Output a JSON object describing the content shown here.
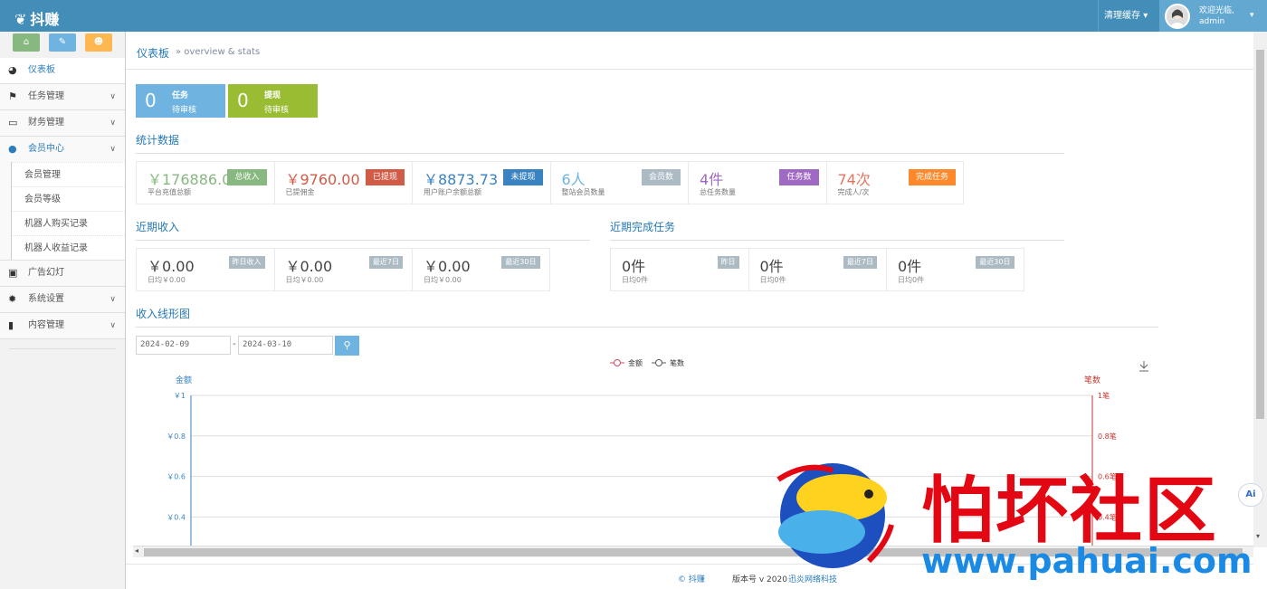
{
  "brand": {
    "name": "抖赚"
  },
  "header": {
    "clear_cache": "清理缓存",
    "welcome": "欢迎光临,",
    "user": "admin"
  },
  "sidebar": {
    "items": [
      {
        "label": "仪表板",
        "icon": "dashboard-icon"
      },
      {
        "label": "任务管理",
        "icon": "flag-icon"
      },
      {
        "label": "财务管理",
        "icon": "inbox-icon"
      },
      {
        "label": "会员中心",
        "icon": "user-icon"
      },
      {
        "label": "广告幻灯",
        "icon": "picture-icon"
      },
      {
        "label": "系统设置",
        "icon": "gear-icon"
      },
      {
        "label": "内容管理",
        "icon": "book-icon"
      }
    ],
    "member_sub": [
      "会员管理",
      "会员等级",
      "机器人购买记录",
      "机器人收益记录"
    ]
  },
  "breadcrumb": {
    "title": "仪表板",
    "sub": "» overview & stats"
  },
  "infoboxes": [
    {
      "num": "0",
      "t1": "任务",
      "t2": "待审核",
      "color": "#6fb3e0"
    },
    {
      "num": "0",
      "t1": "提现",
      "t2": "待审核",
      "color": "#9abc32"
    }
  ],
  "sections": {
    "stats": "统计数据",
    "income": "近期收入",
    "tasks": "近期完成任务",
    "chart": "收入线形图"
  },
  "stats": [
    {
      "value": "￥176886.0",
      "desc": "平台充值总额",
      "tag": "总收入",
      "color": "#87b87f",
      "valcolor": "#87b87f"
    },
    {
      "value": "￥9760.00",
      "desc": "已提佣金",
      "tag": "已提现",
      "color": "#d15b47",
      "valcolor": "#d15b47"
    },
    {
      "value": "￥8873.73",
      "desc": "用户账户余额总额",
      "tag": "未提现",
      "color": "#3983c2",
      "valcolor": "#3983c2"
    },
    {
      "value": "6人",
      "desc": "整站会员数量",
      "tag": "会员数",
      "color": "#abbac3",
      "valcolor": "#6fb3e0"
    },
    {
      "value": "4件",
      "desc": "总任务数量",
      "tag": "任务数",
      "color": "#a069c3",
      "valcolor": "#a069c3"
    },
    {
      "value": "74次",
      "desc": "完成人/次",
      "tag": "完成任务",
      "color": "#ff892a",
      "valcolor": "#e2755f"
    }
  ],
  "income": [
    {
      "value": "￥0.00",
      "desc": "日均￥0.00",
      "tag": "昨日收入"
    },
    {
      "value": "￥0.00",
      "desc": "日均￥0.00",
      "tag": "最近7日"
    },
    {
      "value": "￥0.00",
      "desc": "日均￥0.00",
      "tag": "最近30日"
    }
  ],
  "tasks": [
    {
      "value": "0件",
      "desc": "日均0件",
      "tag": "昨日"
    },
    {
      "value": "0件",
      "desc": "日均0件",
      "tag": "最近7日"
    },
    {
      "value": "0件",
      "desc": "日均0件",
      "tag": "最近30日"
    }
  ],
  "filter": {
    "start": "2024-02-09",
    "end": "2024-03-10",
    "sep": "-"
  },
  "chart_data": {
    "type": "line",
    "series": [
      {
        "name": "金额",
        "values": []
      },
      {
        "name": "笔数",
        "values": []
      }
    ],
    "ylabel_left": "金额",
    "ylabel_right": "笔数",
    "yticks_left": [
      "￥1",
      "￥0.8",
      "￥0.6",
      "￥0.4"
    ],
    "yticks_right": [
      "1笔",
      "0.8笔",
      "0.6笔",
      "0.4笔"
    ],
    "ylim": [
      0,
      1
    ],
    "grid": true,
    "legend": "top-center",
    "colors": {
      "amount": "#d14a61",
      "count": "#5b5b5b"
    }
  },
  "footer": {
    "copy": "© 抖赚",
    "version_label": "版本号 v 2020",
    "company": "迅炎网络科技"
  },
  "watermark": {
    "text": "怕坏社区",
    "url": "www.pahuai.com"
  }
}
